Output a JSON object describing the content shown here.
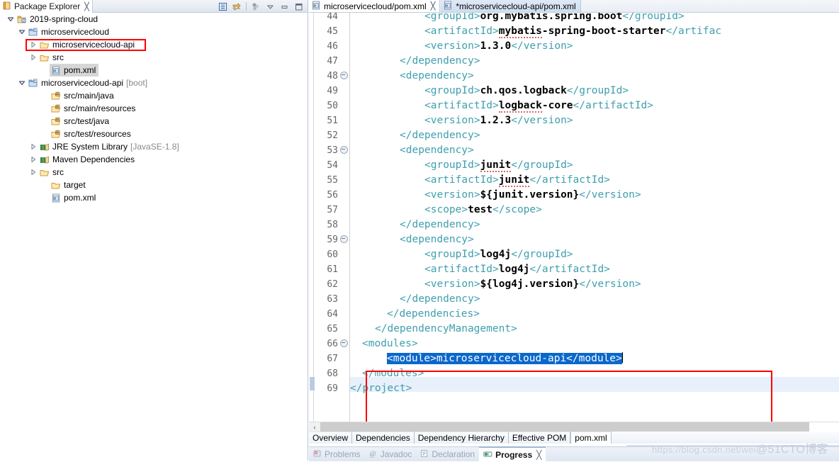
{
  "package_explorer": {
    "title": "Package Explorer",
    "close_glyph": "╳",
    "view_icon": "package-explorer-icon",
    "toolbar": [
      {
        "name": "collapse-all-icon",
        "glyph": "❐"
      },
      {
        "name": "link-with-editor-icon",
        "glyph": "⇄"
      },
      {
        "name": "view-menu-filter-icon",
        "glyph": "∴"
      },
      {
        "name": "view-menu-icon",
        "glyph": "▽"
      },
      {
        "name": "minimize-icon",
        "glyph": "▬"
      },
      {
        "name": "maximize-icon",
        "glyph": "❐"
      }
    ],
    "tree": [
      {
        "label": "2019-spring-cloud",
        "suffix": "",
        "indent": 0,
        "twisty": "down",
        "icon": "java-project-icon",
        "selected": false
      },
      {
        "label": "microservicecloud",
        "suffix": "",
        "indent": 1,
        "twisty": "down",
        "icon": "maven-project-icon",
        "selected": false
      },
      {
        "label": "microservicecloud-api",
        "suffix": "",
        "indent": 2,
        "twisty": "right",
        "icon": "folder-icon",
        "selected": false
      },
      {
        "label": "src",
        "suffix": "",
        "indent": 2,
        "twisty": "right",
        "icon": "folder-icon",
        "selected": false
      },
      {
        "label": "pom.xml",
        "suffix": "",
        "indent": 3,
        "twisty": "none",
        "icon": "xml-file-icon",
        "selected": true
      },
      {
        "label": "microservicecloud-api",
        "suffix": "[boot]",
        "indent": 1,
        "twisty": "down",
        "icon": "maven-project-icon",
        "selected": false
      },
      {
        "label": "src/main/java",
        "suffix": "",
        "indent": 3,
        "twisty": "none",
        "icon": "source-folder-icon",
        "selected": false
      },
      {
        "label": "src/main/resources",
        "suffix": "",
        "indent": 3,
        "twisty": "none",
        "icon": "source-folder-icon",
        "selected": false
      },
      {
        "label": "src/test/java",
        "suffix": "",
        "indent": 3,
        "twisty": "none",
        "icon": "source-folder-icon",
        "selected": false
      },
      {
        "label": "src/test/resources",
        "suffix": "",
        "indent": 3,
        "twisty": "none",
        "icon": "source-folder-icon",
        "selected": false
      },
      {
        "label": "JRE System Library",
        "suffix": "[JavaSE-1.8]",
        "indent": 2,
        "twisty": "right",
        "icon": "library-icon",
        "selected": false
      },
      {
        "label": "Maven Dependencies",
        "suffix": "",
        "indent": 2,
        "twisty": "right",
        "icon": "library-icon",
        "selected": false
      },
      {
        "label": "src",
        "suffix": "",
        "indent": 2,
        "twisty": "right",
        "icon": "folder-icon",
        "selected": false
      },
      {
        "label": "target",
        "suffix": "",
        "indent": 3,
        "twisty": "none",
        "icon": "folder-icon",
        "selected": false
      },
      {
        "label": "pom.xml",
        "suffix": "",
        "indent": 3,
        "twisty": "none",
        "icon": "xml-file-icon",
        "selected": false
      }
    ],
    "highlight_box": {
      "target_label": "microservicecloud-api",
      "color": "#ff0000"
    }
  },
  "editor": {
    "tabs": [
      {
        "label": "microservicecloud/pom.xml",
        "active": true,
        "dirty": false,
        "icon": "xml-file-icon",
        "close_glyph": "╳"
      },
      {
        "label": "*microservicecloud-api/pom.xml",
        "active": false,
        "dirty": true,
        "icon": "xml-file-icon",
        "close_glyph": ""
      }
    ],
    "first_line": 44,
    "last_line": 69,
    "current_line": 67,
    "fold_lines": [
      48,
      53,
      59,
      66
    ],
    "selection_text": "<module>microservicecloud-api</module>",
    "selection_color": "#0a67cc",
    "highlight_box": {
      "from_line": 66,
      "to_line": 68,
      "color": "#ff0000"
    },
    "lines": [
      {
        "n": 44,
        "indent": 6,
        "parts": [
          {
            "t": "tag",
            "s": "<groupId>"
          },
          {
            "t": "txt",
            "s": "org.mybatis.spring.boot"
          },
          {
            "t": "tag",
            "s": "</groupId>"
          }
        ]
      },
      {
        "n": 45,
        "indent": 6,
        "parts": [
          {
            "t": "tag",
            "s": "<artifactId>"
          },
          {
            "t": "sq",
            "s": "mybatis"
          },
          {
            "t": "txt",
            "s": "-spring-boot-starter"
          },
          {
            "t": "tag",
            "s": "</artifac"
          }
        ]
      },
      {
        "n": 46,
        "indent": 6,
        "parts": [
          {
            "t": "tag",
            "s": "<version>"
          },
          {
            "t": "txt",
            "s": "1.3.0"
          },
          {
            "t": "tag",
            "s": "</version>"
          }
        ]
      },
      {
        "n": 47,
        "indent": 4,
        "parts": [
          {
            "t": "tag",
            "s": "</dependency>"
          }
        ]
      },
      {
        "n": 48,
        "indent": 4,
        "parts": [
          {
            "t": "tag",
            "s": "<dependency>"
          }
        ]
      },
      {
        "n": 49,
        "indent": 6,
        "parts": [
          {
            "t": "tag",
            "s": "<groupId>"
          },
          {
            "t": "txt",
            "s": "ch.qos.logback"
          },
          {
            "t": "tag",
            "s": "</groupId>"
          }
        ]
      },
      {
        "n": 50,
        "indent": 6,
        "parts": [
          {
            "t": "tag",
            "s": "<artifactId>"
          },
          {
            "t": "sq",
            "s": "logback"
          },
          {
            "t": "txt",
            "s": "-core"
          },
          {
            "t": "tag",
            "s": "</artifactId>"
          }
        ]
      },
      {
        "n": 51,
        "indent": 6,
        "parts": [
          {
            "t": "tag",
            "s": "<version>"
          },
          {
            "t": "txt",
            "s": "1.2.3"
          },
          {
            "t": "tag",
            "s": "</version>"
          }
        ]
      },
      {
        "n": 52,
        "indent": 4,
        "parts": [
          {
            "t": "tag",
            "s": "</dependency>"
          }
        ]
      },
      {
        "n": 53,
        "indent": 4,
        "parts": [
          {
            "t": "tag",
            "s": "<dependency>"
          }
        ]
      },
      {
        "n": 54,
        "indent": 6,
        "parts": [
          {
            "t": "tag",
            "s": "<groupId>"
          },
          {
            "t": "sq",
            "s": "junit"
          },
          {
            "t": "tag",
            "s": "</groupId>"
          }
        ]
      },
      {
        "n": 55,
        "indent": 6,
        "parts": [
          {
            "t": "tag",
            "s": "<artifactId>"
          },
          {
            "t": "sq",
            "s": "junit"
          },
          {
            "t": "tag",
            "s": "</artifactId>"
          }
        ]
      },
      {
        "n": 56,
        "indent": 6,
        "parts": [
          {
            "t": "tag",
            "s": "<version>"
          },
          {
            "t": "txt",
            "s": "${junit.version}"
          },
          {
            "t": "tag",
            "s": "</version>"
          }
        ]
      },
      {
        "n": 57,
        "indent": 6,
        "parts": [
          {
            "t": "tag",
            "s": "<scope>"
          },
          {
            "t": "txt",
            "s": "test"
          },
          {
            "t": "tag",
            "s": "</scope>"
          }
        ]
      },
      {
        "n": 58,
        "indent": 4,
        "parts": [
          {
            "t": "tag",
            "s": "</dependency>"
          }
        ]
      },
      {
        "n": 59,
        "indent": 4,
        "parts": [
          {
            "t": "tag",
            "s": "<dependency>"
          }
        ]
      },
      {
        "n": 60,
        "indent": 6,
        "parts": [
          {
            "t": "tag",
            "s": "<groupId>"
          },
          {
            "t": "txt",
            "s": "log4j"
          },
          {
            "t": "tag",
            "s": "</groupId>"
          }
        ]
      },
      {
        "n": 61,
        "indent": 6,
        "parts": [
          {
            "t": "tag",
            "s": "<artifactId>"
          },
          {
            "t": "txt",
            "s": "log4j"
          },
          {
            "t": "tag",
            "s": "</artifactId>"
          }
        ]
      },
      {
        "n": 62,
        "indent": 6,
        "parts": [
          {
            "t": "tag",
            "s": "<version>"
          },
          {
            "t": "txt",
            "s": "${log4j.version}"
          },
          {
            "t": "tag",
            "s": "</version>"
          }
        ]
      },
      {
        "n": 63,
        "indent": 4,
        "parts": [
          {
            "t": "tag",
            "s": "</dependency>"
          }
        ]
      },
      {
        "n": 64,
        "indent": 3,
        "parts": [
          {
            "t": "tag",
            "s": "</dependencies>"
          }
        ]
      },
      {
        "n": 65,
        "indent": 2,
        "parts": [
          {
            "t": "tag",
            "s": "</dependencyManagement>"
          }
        ]
      },
      {
        "n": 66,
        "indent": 1,
        "parts": [
          {
            "t": "tag",
            "s": "<modules>"
          }
        ]
      },
      {
        "n": 67,
        "indent": 3,
        "parts": [
          {
            "t": "selstart",
            "s": "<module>"
          },
          {
            "t": "selsq",
            "s": "microservicecloud-api"
          },
          {
            "t": "selend",
            "s": "</module>"
          }
        ]
      },
      {
        "n": 68,
        "indent": 1,
        "parts": [
          {
            "t": "tag",
            "s": "</modules>"
          }
        ]
      },
      {
        "n": 69,
        "indent": 0,
        "parts": [
          {
            "t": "tag",
            "s": "</project>"
          }
        ]
      }
    ],
    "scrollbar": {
      "left_arrow": "‹",
      "right_arrow": "›"
    }
  },
  "form_tabs": [
    {
      "label": "Overview",
      "selected": false
    },
    {
      "label": "Dependencies",
      "selected": false
    },
    {
      "label": "Dependency Hierarchy",
      "selected": false
    },
    {
      "label": "Effective POM",
      "selected": false
    },
    {
      "label": "pom.xml",
      "selected": true
    }
  ],
  "bottom_views": [
    {
      "label": "Problems",
      "icon": "problems-icon",
      "active": false,
      "close_glyph": ""
    },
    {
      "label": "Javadoc",
      "icon": "javadoc-icon",
      "active": false,
      "close_glyph": ""
    },
    {
      "label": "Declaration",
      "icon": "declaration-icon",
      "active": false,
      "close_glyph": ""
    },
    {
      "label": "Progress",
      "icon": "progress-icon",
      "active": true,
      "close_glyph": "╳"
    }
  ],
  "watermark": {
    "url": "https://blog.csdn.net/wei",
    "handle": "@51CTO博客"
  }
}
